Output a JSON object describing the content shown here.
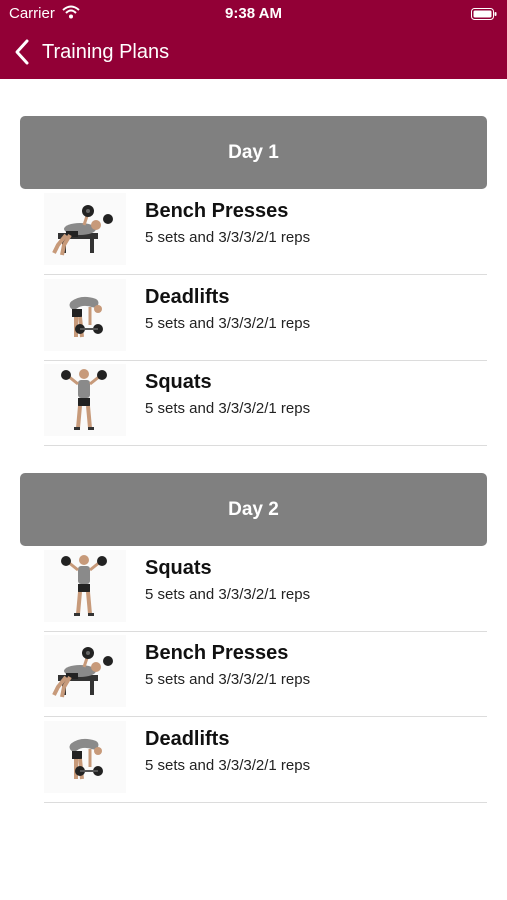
{
  "status_bar": {
    "carrier": "Carrier",
    "time": "9:38 AM",
    "wifi_icon": "wifi-icon",
    "battery_icon": "battery-icon"
  },
  "nav": {
    "back_icon": "chevron-left-icon",
    "title": "Training Plans"
  },
  "colors": {
    "nav_background": "#920036",
    "day_header_background": "#808080"
  },
  "days": [
    {
      "label": "Day 1",
      "exercises": [
        {
          "name": "Bench Presses",
          "detail": "5 sets and 3/3/3/2/1 reps",
          "image": "bench-press-image"
        },
        {
          "name": "Deadlifts",
          "detail": "5 sets and 3/3/3/2/1 reps",
          "image": "deadlift-image"
        },
        {
          "name": "Squats",
          "detail": "5 sets and 3/3/3/2/1 reps",
          "image": "squat-image"
        }
      ]
    },
    {
      "label": "Day 2",
      "exercises": [
        {
          "name": "Squats",
          "detail": "5 sets and 3/3/3/2/1 reps",
          "image": "squat-image"
        },
        {
          "name": "Bench Presses",
          "detail": "5 sets and 3/3/3/2/1 reps",
          "image": "bench-press-image"
        },
        {
          "name": "Deadlifts",
          "detail": "5 sets and 3/3/3/2/1 reps",
          "image": "deadlift-image"
        }
      ]
    }
  ]
}
